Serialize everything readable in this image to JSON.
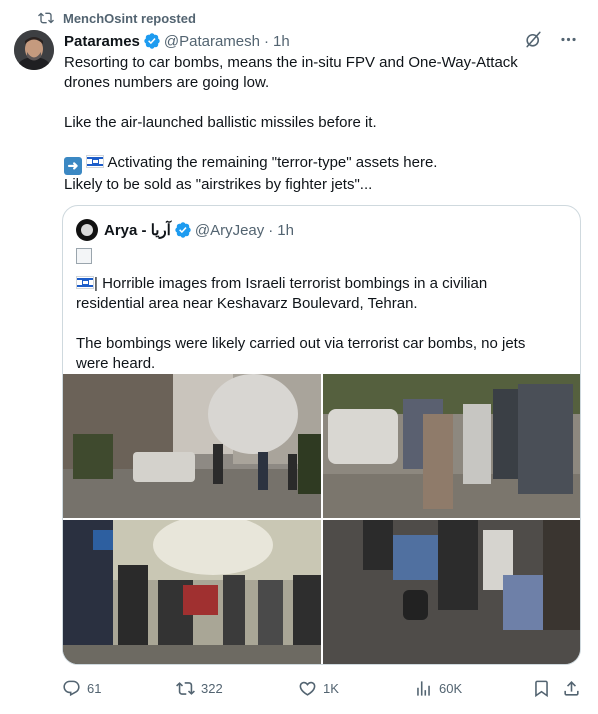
{
  "repost": {
    "icon": "repost-icon",
    "label": "MenchOsint reposted"
  },
  "tweet": {
    "author_name": "Patarames",
    "handle": "@Pataramesh",
    "dot": "·",
    "time": "1h",
    "lines": [
      "Resorting to car bombs, means the in-situ FPV and One-Way-Attack",
      "drones numbers are going low.",
      "Like the air-launched ballistic missiles before it.",
      " Activating the remaining \"terror-type\" assets here.",
      "Likely to be sold as \"airstrikes by fighter jets\"..."
    ]
  },
  "quote": {
    "author_name": "Arya - آریا",
    "handle": "@AryJeay",
    "dot": "·",
    "time": "1h",
    "line1": "| Horrible images from Israeli terrorist bombings in a civilian",
    "line2": "residential area near Keshavarz Boulevard, Tehran.",
    "line3": "The bombings were likely carried out via terrorist car bombs, no jets",
    "line4": "were heard."
  },
  "actions": {
    "replies": "61",
    "reposts": "322",
    "likes": "1K",
    "views": "60K"
  },
  "colors": {
    "verified": "#1d9bf0",
    "muted": "#536471",
    "border": "#cfd9de"
  }
}
